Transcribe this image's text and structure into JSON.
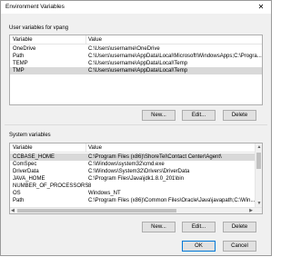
{
  "window": {
    "title": "Environment Variables",
    "close_glyph": "✕"
  },
  "user_vars": {
    "group_label": "User variables for vpang",
    "headers": {
      "variable": "Variable",
      "value": "Value"
    },
    "rows": [
      {
        "variable": "OneDrive",
        "value": "C:\\Users\\username\\OneDrive"
      },
      {
        "variable": "Path",
        "value": "C:\\Users\\username\\AppData\\Local\\Microsoft\\WindowsApps;C:\\Progra..."
      },
      {
        "variable": "TEMP",
        "value": "C:\\Users\\username\\AppData\\Local\\Temp"
      },
      {
        "variable": "TMP",
        "value": "C:\\Users\\username\\AppData\\Local\\Temp"
      }
    ],
    "selected_index": 3,
    "buttons": {
      "new": "New...",
      "edit": "Edit...",
      "delete": "Delete"
    }
  },
  "system_vars": {
    "group_label": "System variables",
    "headers": {
      "variable": "Variable",
      "value": "Value"
    },
    "rows": [
      {
        "variable": "CCBASE_HOME",
        "value": "C:\\Program Files (x86)\\ShoreTel\\Contact Center\\Agent\\"
      },
      {
        "variable": "ComSpec",
        "value": "C:\\Windows\\system32\\cmd.exe"
      },
      {
        "variable": "DriverData",
        "value": "C:\\Windows\\System32\\Drivers\\DriverData"
      },
      {
        "variable": "JAVA_HOME",
        "value": "C:\\Program Files\\Java\\jdk1.8.0_201\\bin"
      },
      {
        "variable": "NUMBER_OF_PROCESSORS",
        "value": "8"
      },
      {
        "variable": "OS",
        "value": "Windows_NT"
      },
      {
        "variable": "Path",
        "value": "C:\\Program Files (x86)\\Common Files\\Oracle\\Java\\javapath;C:\\Win..."
      }
    ],
    "selected_index": 0,
    "buttons": {
      "new": "New...",
      "edit": "Edit...",
      "delete": "Delete"
    }
  },
  "dialog_buttons": {
    "ok": "OK",
    "cancel": "Cancel"
  },
  "colors": {
    "selection": "#d9d9d9",
    "default_button_border": "#0078d7",
    "dialog_bg": "#f0f0f0"
  }
}
